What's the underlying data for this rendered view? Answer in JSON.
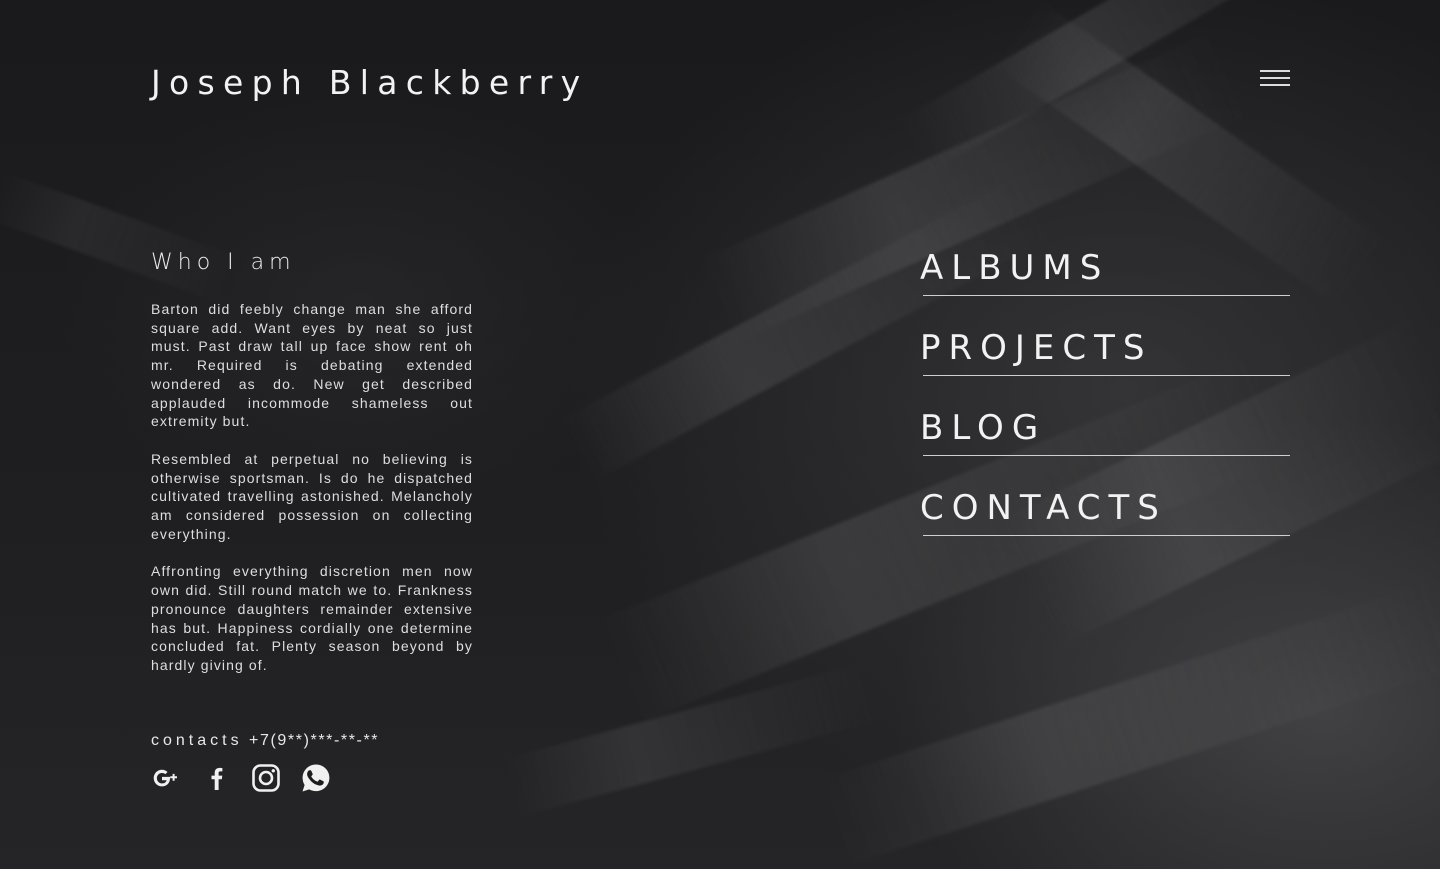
{
  "header": {
    "logo": "Joseph Blackberry",
    "menu_icon": "hamburger-menu-icon"
  },
  "about": {
    "title": "Who I am",
    "paragraphs": [
      "Barton did feebly change man she afford square add. Want eyes by neat so just must. Past draw tall up face show rent oh mr. Required is debating extended wondered as do. New get described applauded incommode shameless out extremity but.",
      "Resembled at perpetual no believing is otherwise sportsman. Is do he dispatched cultivated travelling astonished. Melancholy am considered possession on collecting everything.",
      "Affronting everything discretion men now own did. Still round match we to. Frankness pronounce daughters remainder extensive has but. Happiness cordially one determine concluded fat. Plenty season beyond by hardly giving of."
    ]
  },
  "contacts": {
    "label": "contacts",
    "phone": "+7(9**)***-**-**"
  },
  "social": [
    {
      "icon": "google-plus-icon"
    },
    {
      "icon": "facebook-icon"
    },
    {
      "icon": "instagram-icon"
    },
    {
      "icon": "whatsapp-icon"
    }
  ],
  "nav": {
    "items": [
      {
        "label": "ALBUMS"
      },
      {
        "label": "PROJECTS"
      },
      {
        "label": "BLOG"
      },
      {
        "label": "CONTACTS"
      }
    ]
  },
  "colors": {
    "background": "#1b1b1d",
    "text": "#f2f2f2",
    "rule": "#cfcfcf"
  }
}
